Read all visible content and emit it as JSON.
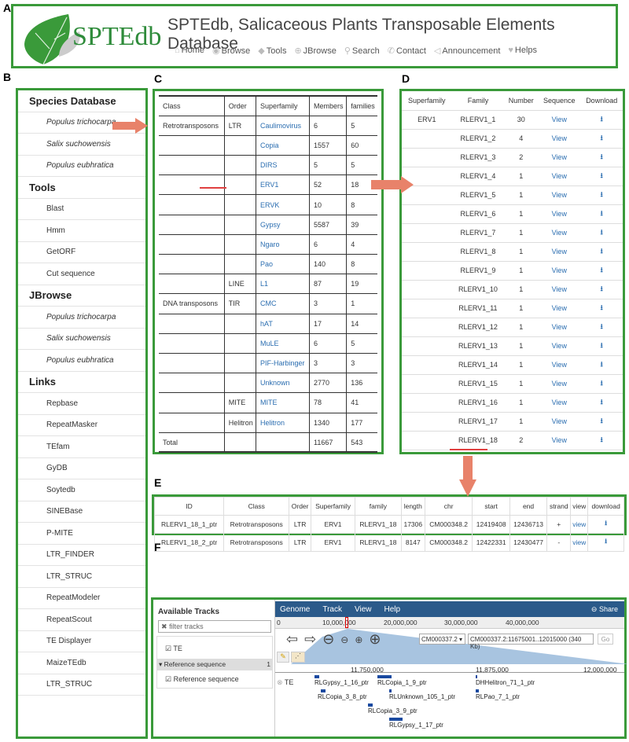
{
  "labels": {
    "a": "A",
    "b": "B",
    "c": "C",
    "d": "D",
    "e": "E",
    "f": "F"
  },
  "header": {
    "logo_text": "SPTEdb",
    "title": "SPTEdb, Salicaceous Plants Transposable Elements Database",
    "nav": [
      {
        "icon": "home-icon",
        "label": "Home"
      },
      {
        "icon": "eye-icon",
        "label": "Browse"
      },
      {
        "icon": "tags-icon",
        "label": "Tools"
      },
      {
        "icon": "zoom-icon",
        "label": "JBrowse"
      },
      {
        "icon": "search-icon",
        "label": "Search"
      },
      {
        "icon": "phone-icon",
        "label": "Contact"
      },
      {
        "icon": "bullhorn-icon",
        "label": "Announcement"
      },
      {
        "icon": "heart-icon",
        "label": "Helps"
      }
    ]
  },
  "sidebar": {
    "items": [
      {
        "label": "Species Database",
        "type": "h"
      },
      {
        "label": "Populus trichocarpa",
        "type": "it"
      },
      {
        "label": "Salix suchowensis",
        "type": "it"
      },
      {
        "label": "Populus eubhratica",
        "type": "it"
      },
      {
        "label": "Tools",
        "type": "h"
      },
      {
        "label": "Blast"
      },
      {
        "label": "Hmm"
      },
      {
        "label": "GetORF"
      },
      {
        "label": "Cut sequence"
      },
      {
        "label": "JBrowse",
        "type": "h"
      },
      {
        "label": "Populus trichocarpa",
        "type": "it"
      },
      {
        "label": "Salix suchowensis",
        "type": "it"
      },
      {
        "label": "Populus eubhratica",
        "type": "it"
      },
      {
        "label": "Links",
        "type": "h"
      },
      {
        "label": "Repbase"
      },
      {
        "label": "RepeatMasker"
      },
      {
        "label": "TEfam"
      },
      {
        "label": "GyDB"
      },
      {
        "label": "Soytedb"
      },
      {
        "label": "SINEBase"
      },
      {
        "label": "P-MITE"
      },
      {
        "label": "LTR_FINDER"
      },
      {
        "label": "LTR_STRUC"
      },
      {
        "label": "RepeatModeler"
      },
      {
        "label": "RepeatScout"
      },
      {
        "label": "TE Displayer"
      },
      {
        "label": "MaizeTEdb"
      },
      {
        "label": "LTR_STRUC"
      }
    ]
  },
  "superfamily_table": {
    "headers": [
      "Class",
      "Order",
      "Superfamily",
      "Members",
      "families"
    ],
    "rows": [
      [
        "Retrotransposons",
        "LTR",
        "Caulimovirus",
        "6",
        "5"
      ],
      [
        "",
        "",
        "Copia",
        "1557",
        "60"
      ],
      [
        "",
        "",
        "DIRS",
        "5",
        "5"
      ],
      [
        "",
        "",
        "ERV1",
        "52",
        "18"
      ],
      [
        "",
        "",
        "ERVK",
        "10",
        "8"
      ],
      [
        "",
        "",
        "Gypsy",
        "5587",
        "39"
      ],
      [
        "",
        "",
        "Ngaro",
        "6",
        "4"
      ],
      [
        "",
        "",
        "Pao",
        "140",
        "8"
      ],
      [
        "",
        "LINE",
        "L1",
        "87",
        "19"
      ],
      [
        "DNA transposons",
        "TIR",
        "CMC",
        "3",
        "1"
      ],
      [
        "",
        "",
        "hAT",
        "17",
        "14"
      ],
      [
        "",
        "",
        "MuLE",
        "6",
        "5"
      ],
      [
        "",
        "",
        "PIF-Harbinger",
        "3",
        "3"
      ],
      [
        "",
        "",
        "Unknown",
        "2770",
        "136"
      ],
      [
        "",
        "MITE",
        "MITE",
        "78",
        "41"
      ],
      [
        "",
        "Helitron",
        "Helitron",
        "1340",
        "177"
      ],
      [
        "Total",
        "",
        "",
        "11667",
        "543"
      ]
    ]
  },
  "family_table": {
    "headers": [
      "Superfamily",
      "Family",
      "Number",
      "Sequence",
      "Download"
    ],
    "view_label": "View",
    "rows": [
      [
        "ERV1",
        "RLERV1_1",
        "30"
      ],
      [
        "",
        "RLERV1_2",
        "4"
      ],
      [
        "",
        "RLERV1_3",
        "2"
      ],
      [
        "",
        "RLERV1_4",
        "1"
      ],
      [
        "",
        "RLERV1_5",
        "1"
      ],
      [
        "",
        "RLERV1_6",
        "1"
      ],
      [
        "",
        "RLERV1_7",
        "1"
      ],
      [
        "",
        "RLERV1_8",
        "1"
      ],
      [
        "",
        "RLERV1_9",
        "1"
      ],
      [
        "",
        "RLERV1_10",
        "1"
      ],
      [
        "",
        "RLERV1_11",
        "1"
      ],
      [
        "",
        "RLERV1_12",
        "1"
      ],
      [
        "",
        "RLERV1_13",
        "1"
      ],
      [
        "",
        "RLERV1_14",
        "1"
      ],
      [
        "",
        "RLERV1_15",
        "1"
      ],
      [
        "",
        "RLERV1_16",
        "1"
      ],
      [
        "",
        "RLERV1_17",
        "1"
      ],
      [
        "",
        "RLERV1_18",
        "2"
      ]
    ]
  },
  "element_table": {
    "headers": [
      "ID",
      "Class",
      "Order",
      "Superfamily",
      "family",
      "length",
      "chr",
      "start",
      "end",
      "strand",
      "view",
      "download"
    ],
    "view_label": "view",
    "rows": [
      [
        "RLERV1_18_1_ptr",
        "Retrotransposons",
        "LTR",
        "ERV1",
        "RLERV1_18",
        "17306",
        "CM000348.2",
        "12419408",
        "12436713",
        "+"
      ],
      [
        "RLERV1_18_2_ptr",
        "Retrotransposons",
        "LTR",
        "ERV1",
        "RLERV1_18",
        "8147",
        "CM000348.2",
        "12422331",
        "12430477",
        "-"
      ]
    ]
  },
  "jbrowse": {
    "available_tracks": "Available Tracks",
    "filter_placeholder": "filter tracks",
    "track_te": "TE",
    "ref_section": "Reference sequence",
    "ref_count": "1",
    "ref_track": "Reference sequence",
    "menu": [
      "Genome",
      "Track",
      "View",
      "Help"
    ],
    "share": "Share",
    "ruler": [
      "0",
      "10,000,000",
      "20,000,000",
      "30,000,000",
      "40,000,000"
    ],
    "chrom": "CM000337.2",
    "location": "CM000337.2:11675001..12015000 (340 Kb)",
    "go": "Go",
    "scale": [
      "11,750,000",
      "11,875,000",
      "12,000,000"
    ],
    "track_label": "TE",
    "features": [
      "RLGypsy_1_16_ptr",
      "RLCopia_3_8_ptr",
      "RLCopia_3_9_ptr",
      "RLCopia_1_9_ptr",
      "RLUnknown_105_1_ptr",
      "RLGypsy_1_17_ptr",
      "DHHelitron_71_1_ptr",
      "RLPao_7_1_ptr"
    ]
  },
  "colors": {
    "panel_border": "#3a9a3a",
    "link": "#2a6db0",
    "arrow": "#e8826a",
    "menubar": "#2b5a8a"
  }
}
